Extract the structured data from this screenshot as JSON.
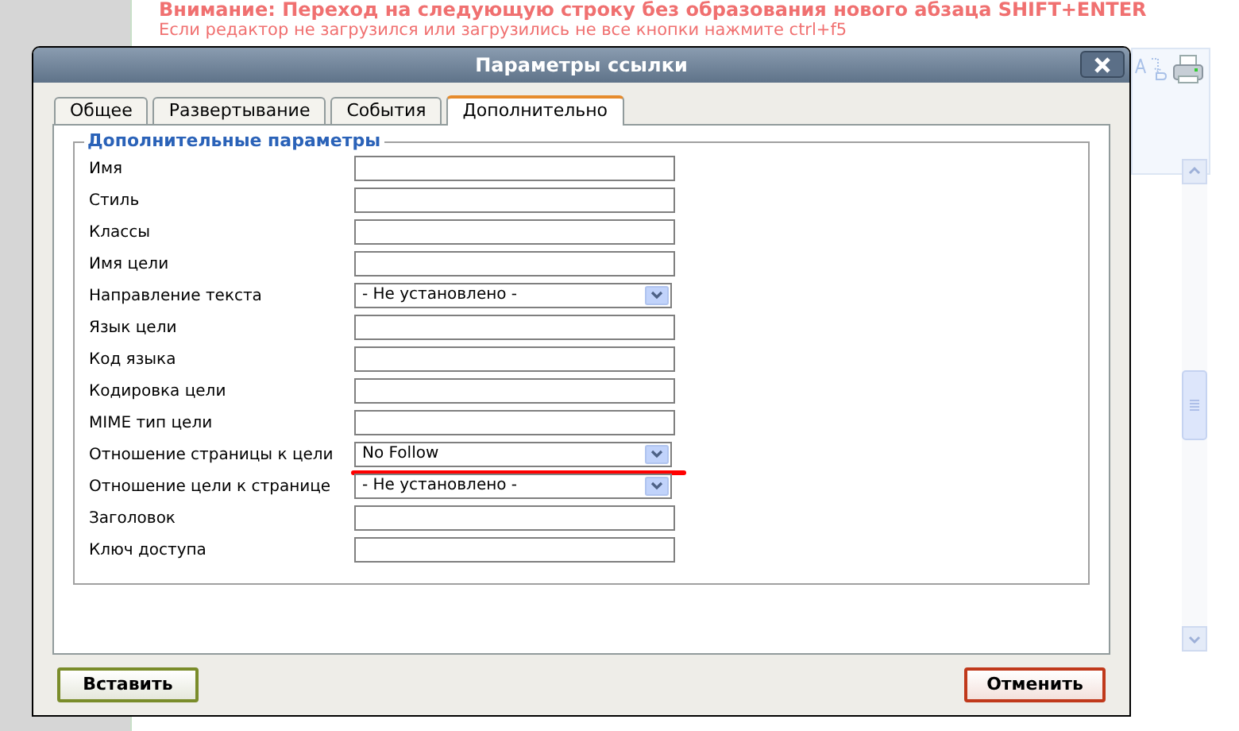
{
  "notice": [
    "Внимание: Переход на следующую строку без образования нового абзаца SHIFT+ENTER",
    "Если редактор не загрузился или загрузились не все кнопки нажмите ctrl+f5"
  ],
  "dialog": {
    "title": "Параметры ссылки",
    "tabs": [
      {
        "label": "Общее",
        "selected": false
      },
      {
        "label": "Развертывание",
        "selected": false
      },
      {
        "label": "События",
        "selected": false
      },
      {
        "label": "Дополнительно",
        "selected": true
      }
    ],
    "group_title": "Дополнительные параметры",
    "fields": [
      {
        "label": "Имя",
        "kind": "text"
      },
      {
        "label": "Стиль",
        "kind": "text"
      },
      {
        "label": "Классы",
        "kind": "text"
      },
      {
        "label": "Имя цели",
        "kind": "text"
      },
      {
        "label": "Направление текста",
        "kind": "select",
        "value": "- Не установлено -"
      },
      {
        "label": "Язык цели",
        "kind": "text"
      },
      {
        "label": "Код языка",
        "kind": "text"
      },
      {
        "label": "Кодировка цели",
        "kind": "text"
      },
      {
        "label": "MIME тип цели",
        "kind": "text"
      },
      {
        "label": "Отношение страницы к цели",
        "kind": "select",
        "value": "No Follow",
        "underlined": true
      },
      {
        "label": "Отношение цели к странице",
        "kind": "select",
        "value": "- Не установлено -"
      },
      {
        "label": "Заголовок",
        "kind": "text"
      },
      {
        "label": "Ключ доступа",
        "kind": "text"
      }
    ],
    "buttons": [
      {
        "label": "Вставить",
        "kind": "insert"
      },
      {
        "label": "Отменить",
        "kind": "cancel"
      }
    ]
  }
}
